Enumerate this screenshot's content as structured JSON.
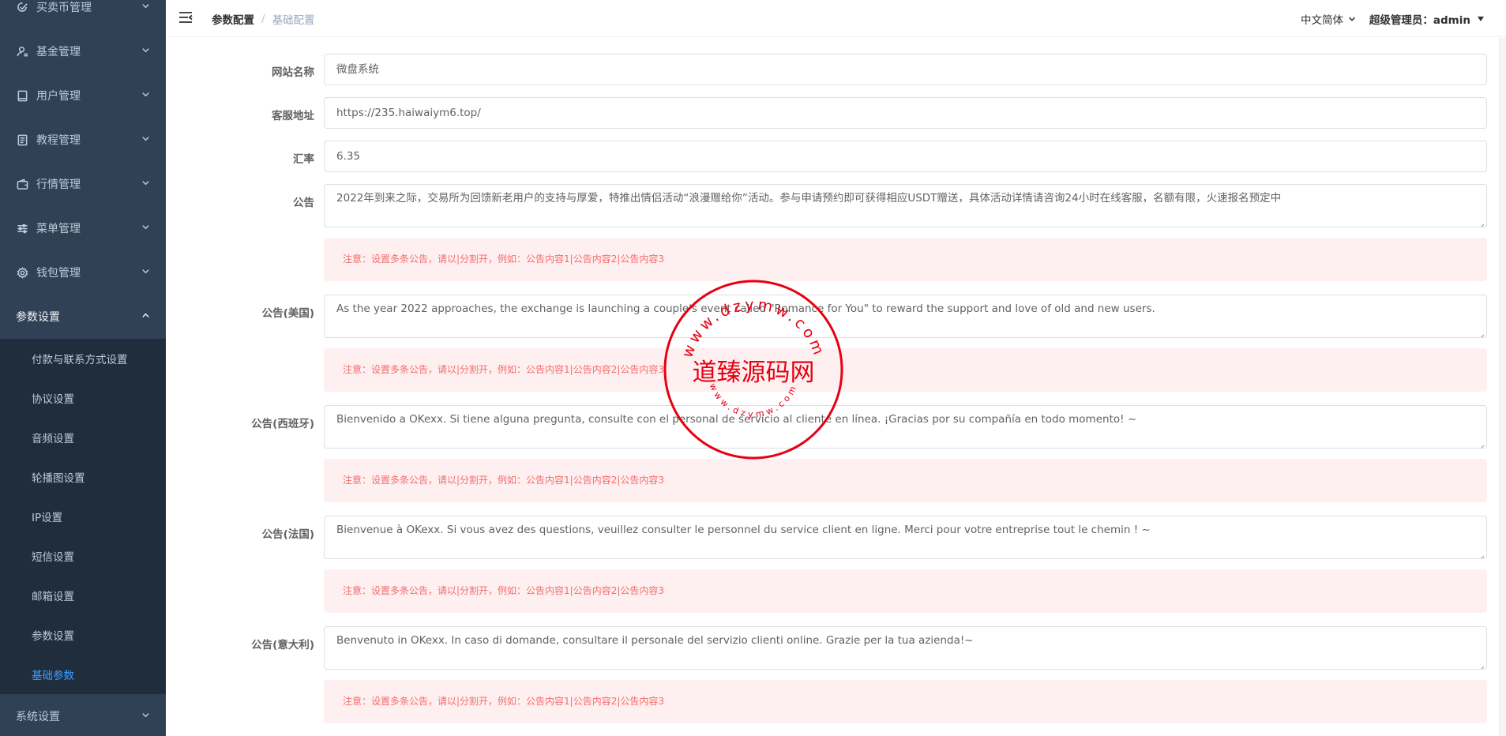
{
  "sidebar": {
    "items": [
      {
        "label": "买卖币管理",
        "icon": "check-circle-icon"
      },
      {
        "label": "基金管理",
        "icon": "user-icon"
      },
      {
        "label": "用户管理",
        "icon": "book-icon"
      },
      {
        "label": "教程管理",
        "icon": "document-icon"
      },
      {
        "label": "行情管理",
        "icon": "wallet-icon"
      },
      {
        "label": "菜单管理",
        "icon": "sliders-icon"
      },
      {
        "label": "钱包管理",
        "icon": "gear-icon"
      }
    ],
    "opened": {
      "label": "参数设置",
      "children": [
        "付款与联系方式设置",
        "协议设置",
        "音频设置",
        "轮播图设置",
        "IP设置",
        "短信设置",
        "邮箱设置",
        "参数设置",
        "基础参数"
      ]
    },
    "bottom": {
      "label": "系统设置"
    }
  },
  "header": {
    "breadcrumb": [
      "参数配置",
      "基础配置"
    ],
    "breadcrumb_separator": "/",
    "language": "中文简体",
    "user": "超级管理员：admin"
  },
  "form": {
    "site_name": {
      "label": "网站名称",
      "value": "微盘系统"
    },
    "service_url": {
      "label": "客服地址",
      "value": "https://235.haiwaiym6.top/"
    },
    "exchange_rate": {
      "label": "汇率",
      "value": "6.35"
    },
    "notices": [
      {
        "label": "公告",
        "value": "2022年到来之际，交易所为回馈新老用户的支持与厚爱，特推出情侣活动“浪漫赠给你”活动。参与申请预约即可获得相应USDT赠送，具体活动详情请咨询24小时在线客服，名额有限，火速报名预定中"
      },
      {
        "label": "公告(美国)",
        "value": "As the year 2022 approaches, the exchange is launching a couple's event called \"Romance for You\" to reward the support and love of old and new users."
      },
      {
        "label": "公告(西班牙)",
        "value": "Bienvenido a OKexx. Si tiene alguna pregunta, consulte con el personal de servicio al cliente en línea. ¡Gracias por su compañía en todo momento! ~"
      },
      {
        "label": "公告(法国)",
        "value": "Bienvenue à OKexx. Si vous avez des questions, veuillez consulter le personnel du service client en ligne. Merci pour votre entreprise tout le chemin ! ~"
      },
      {
        "label": "公告(意大利)",
        "value": "Benvenuto in OKexx. In caso di domande, consultare il personale del servizio clienti online. Grazie per la tua azienda!~"
      }
    ],
    "notice_hint": "注意：设置多条公告，请以|分割开，例如：公告内容1|公告内容2|公告内容3"
  },
  "watermark": {
    "center_text": "道臻源码网",
    "ring_text": "www.dzymw.com",
    "color": "#e60012"
  },
  "colors": {
    "sidebar_bg": "#304156",
    "submenu_bg": "#1f2d3d",
    "active": "#409eff",
    "alert_bg": "#fef0f0",
    "alert_text": "#f56c6c"
  }
}
